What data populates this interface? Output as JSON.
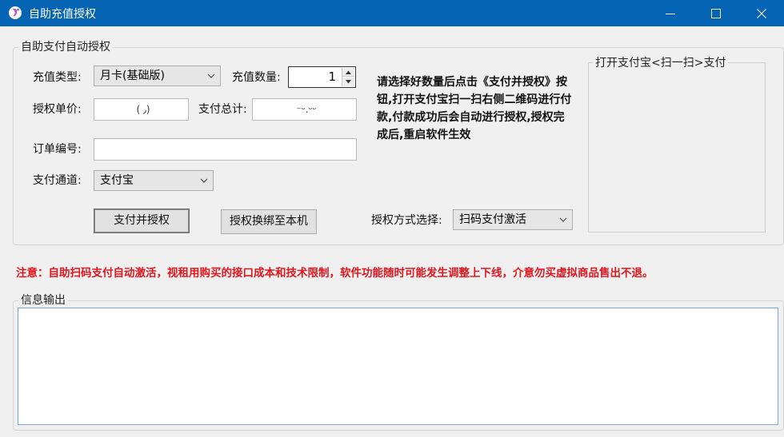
{
  "window": {
    "title": "自助充值授权",
    "title_bar_color": "#0664b4"
  },
  "auto_pay_group": {
    "legend": "自助支付自动授权",
    "recharge_type": {
      "label": "充值类型:",
      "value": "月卡(基础版)"
    },
    "recharge_qty": {
      "label": "充值数量:",
      "value": "1"
    },
    "unit_price": {
      "label": "授权单价:",
      "value": "( ٫)"
    },
    "total_pay": {
      "label": "支付总计:",
      "value": "⁻ᵕ.ᵕᵕ"
    },
    "order_no": {
      "label": "订单编号:",
      "value": ""
    },
    "pay_channel": {
      "label": "支付通道:",
      "value": "支付宝"
    },
    "pay_button": "支付并授权",
    "rebind_button": "授权换绑至本机",
    "instructions": "请选择好数量后点击《支付并授权》按钮,打开支付宝扫一扫右侧二维码进行付款,付款成功后会自动进行授权,授权完成后,重启软件生效",
    "auth_method": {
      "label": "授权方式选择:",
      "value": "扫码支付激活"
    },
    "qr_legend": "打开支付宝<扫一扫>支付"
  },
  "notice": {
    "text": "注意：自助扫码支付自动激活，视租用购买的接口成本和技术限制，软件功能随时可能发生调整上下线，介意勿买虚拟商品售出不退。",
    "color": "#e0161e"
  },
  "output_group": {
    "legend": "信息输出",
    "content": ""
  }
}
